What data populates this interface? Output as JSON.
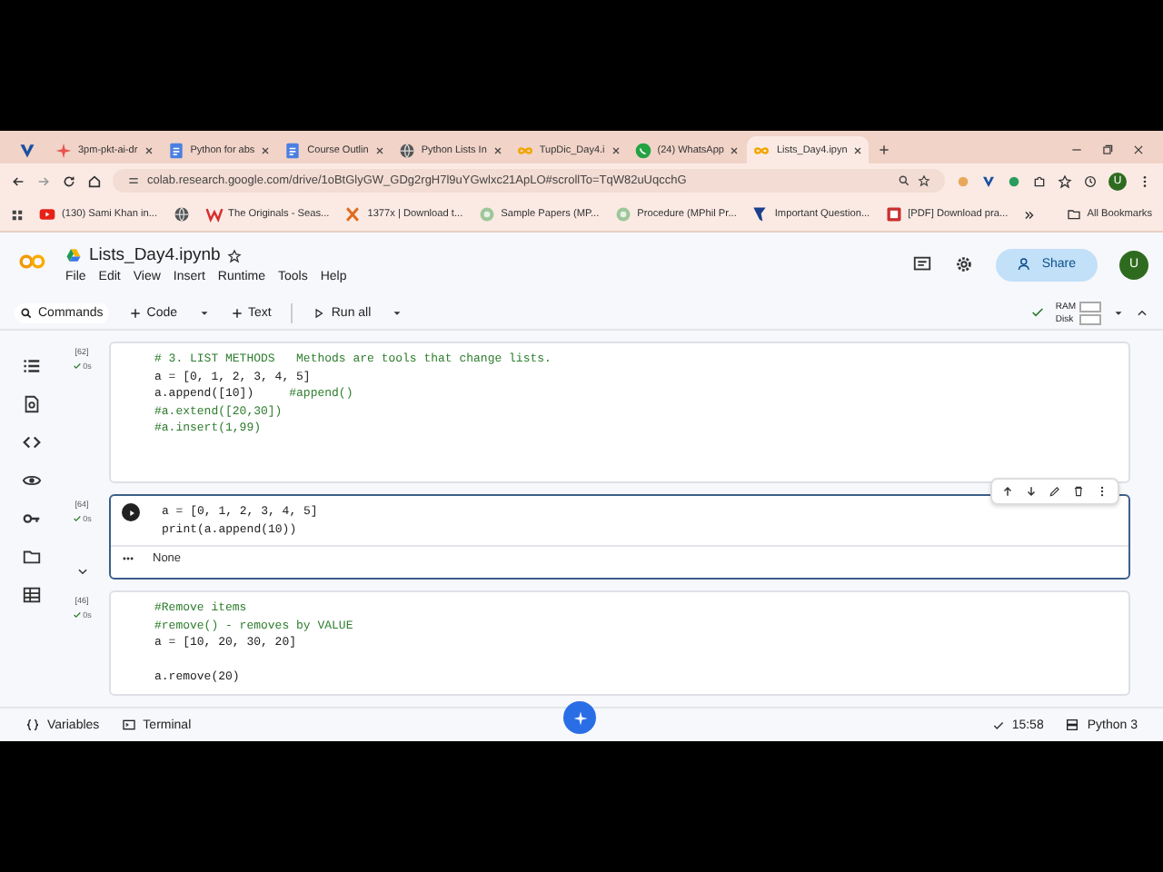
{
  "browser": {
    "tabs": [
      {
        "selected": false
      },
      {
        "title": "3pm-pkt-ai-dr",
        "selected": false
      },
      {
        "title": "Python for abs",
        "selected": false
      },
      {
        "title": "Course Outlin",
        "selected": false
      },
      {
        "title": "Python Lists In",
        "selected": false
      },
      {
        "title": "TupDic_Day4.i",
        "selected": false
      },
      {
        "title": "(24) WhatsApp",
        "selected": false
      },
      {
        "title": "Lists_Day4.ipyn",
        "selected": true
      }
    ],
    "address": "colab.research.google.com/drive/1oBtGlyGW_GDg2rgH7l9uYGwlxc21ApLO#scrollTo=TqW82uUqcchG",
    "profile": "U",
    "bookmarks": [
      {
        "kind": "link",
        "label": "(130) Sami Khan in..."
      },
      {
        "kind": "icon"
      },
      {
        "kind": "link",
        "label": "The Originals - Seas..."
      },
      {
        "kind": "link",
        "label": "1377x | Download t..."
      },
      {
        "kind": "link",
        "label": "Sample Papers (MP..."
      },
      {
        "kind": "link",
        "label": "Procedure (MPhil Pr..."
      },
      {
        "kind": "link",
        "label": "Important Question..."
      },
      {
        "kind": "link",
        "label": "[PDF] Download pra..."
      }
    ],
    "all_bookmarks": "All Bookmarks"
  },
  "colab": {
    "title": "Lists_Day4.ipynb",
    "menu": [
      "File",
      "Edit",
      "View",
      "Insert",
      "Runtime",
      "Tools",
      "Help"
    ],
    "share": "Share",
    "avatar": "U",
    "toolbar": {
      "commands": "Commands",
      "code": "Code",
      "text": "Text",
      "run_all": "Run all",
      "ram": "RAM",
      "disk": "Disk"
    },
    "cells": [
      {
        "exec": "[62]",
        "time": "0s",
        "focused": false,
        "lines": [
          {
            "kind": "code",
            "comment": "# 3. LIST METHODS   Methods are tools that change lists."
          },
          {
            "kind": "code",
            "code": "a = [0, 1, 2, 3, 4, 5]"
          },
          {
            "kind": "code",
            "code": "a.append([10])     ",
            "comment": "#append()"
          },
          {
            "kind": "code",
            "comment": "#a.extend([20,30])"
          },
          {
            "kind": "code",
            "comment": "#a.insert(1,99)"
          }
        ]
      },
      {
        "exec": "[64]",
        "time": "0s",
        "focused": true,
        "output": "None",
        "lines": [
          {
            "kind": "code",
            "code": "a = [0, 1, 2, 3, 4, 5]"
          },
          {
            "kind": "code",
            "code": "print(a.append(10))"
          }
        ]
      },
      {
        "exec": "[46]",
        "time": "0s",
        "focused": false,
        "lines": [
          {
            "kind": "code",
            "comment": "#Remove items"
          },
          {
            "kind": "code",
            "comment": "#remove() - removes by VALUE"
          },
          {
            "kind": "code",
            "code": "a = [10, 20, 30, 20]"
          },
          {
            "kind": "blank"
          },
          {
            "kind": "code",
            "code": "a.remove(20)"
          }
        ]
      }
    ],
    "status": {
      "variables": "Variables",
      "terminal": "Terminal",
      "time": "15:58",
      "runtime": "Python 3"
    }
  }
}
